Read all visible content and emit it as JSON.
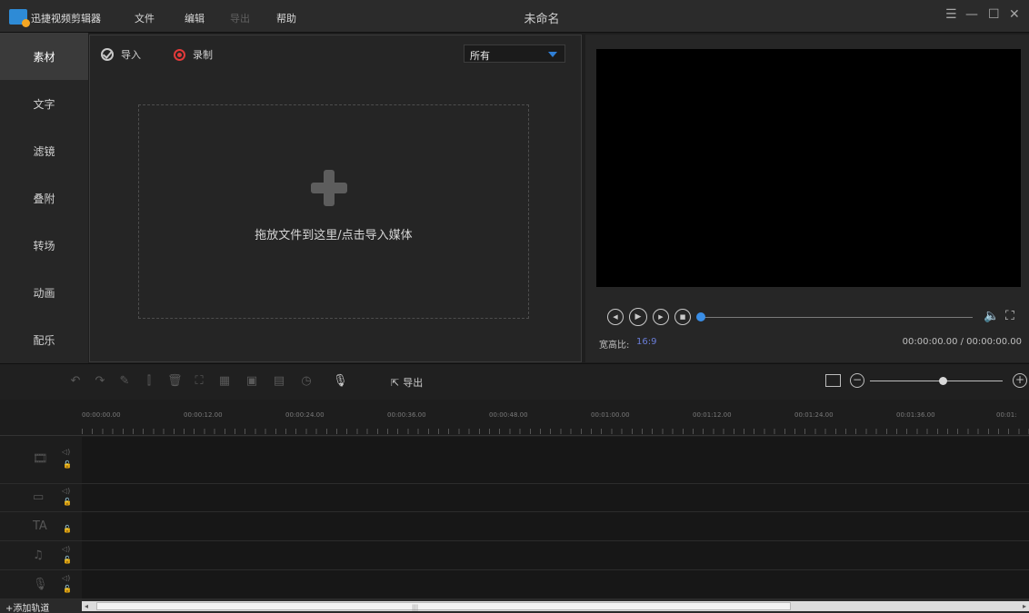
{
  "titlebar": {
    "app_name": "迅捷视频剪辑器",
    "menus": [
      "文件",
      "编辑",
      "导出",
      "帮助"
    ],
    "doc_title": "未命名",
    "window_controls": [
      "☰",
      "—",
      "☐",
      "✕"
    ]
  },
  "nav": {
    "items": [
      "素材",
      "文字",
      "滤镜",
      "叠附",
      "转场",
      "动画",
      "配乐"
    ],
    "active": "素材"
  },
  "media": {
    "import_label": "导入",
    "record_label": "录制",
    "filter_value": "所有",
    "drop_hint": "拖放文件到这里/点击导入媒体"
  },
  "preview": {
    "ratio_label": "宽高比:",
    "ratio_value": "16:9",
    "timecode": "00:00:00.00 / 00:00:00.00",
    "seek_progress": 0
  },
  "timeline": {
    "export_label": "导出",
    "ruler_labels": [
      "00:00:00.00",
      "00:00:12.00",
      "00:00:24.00",
      "00:00:36.00",
      "00:00:48.00",
      "00:01:00.00",
      "00:01:12.00",
      "00:01:24.00",
      "00:01:36.00",
      "00:01:"
    ],
    "zoom_level": 0.55
  },
  "bottom": {
    "add_track_label": "+添加轨道"
  },
  "colors": {
    "accent_blue": "#3a8ee6",
    "record_red": "#e23a3a",
    "ratio_blue": "#6a7dd8"
  }
}
